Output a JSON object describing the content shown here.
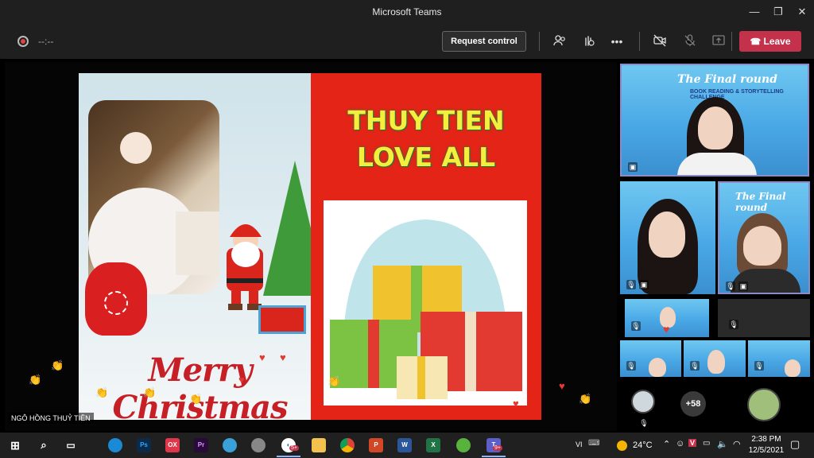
{
  "window": {
    "title": "Microsoft Teams"
  },
  "toolbar": {
    "timer": "--:--",
    "request_control": "Request control",
    "leave_label": "Leave"
  },
  "slide": {
    "title_line1": "THUY TIEN",
    "title_line2": "LOVE ALL",
    "greeting": "Merry Christmas"
  },
  "presenter": {
    "name": "NGÔ HỒNG THUỶ TIÊN"
  },
  "participants": {
    "banner_title": "The Final round",
    "banner_sub": "BOOK READING & STORYTELLING CHALLENGE",
    "overflow_count": "+58"
  },
  "taskbar": {
    "apps": [
      "windows",
      "search",
      "task-view",
      "edge",
      "photoshop",
      "app-ox",
      "premiere",
      "app-bird",
      "app-gauge",
      "app-mail",
      "file-explorer",
      "chrome",
      "powerpoint",
      "word",
      "excel",
      "app-green",
      "teams"
    ],
    "badges": {
      "app-mail": "5+",
      "teams": "9+"
    },
    "weather": "24°C",
    "lang": "VI",
    "time": "2:38 PM",
    "date": "12/5/2021"
  },
  "colors": {
    "leave": "#c4314b",
    "slide_red": "#e32417",
    "title_yellow": "#f4ee3c"
  }
}
